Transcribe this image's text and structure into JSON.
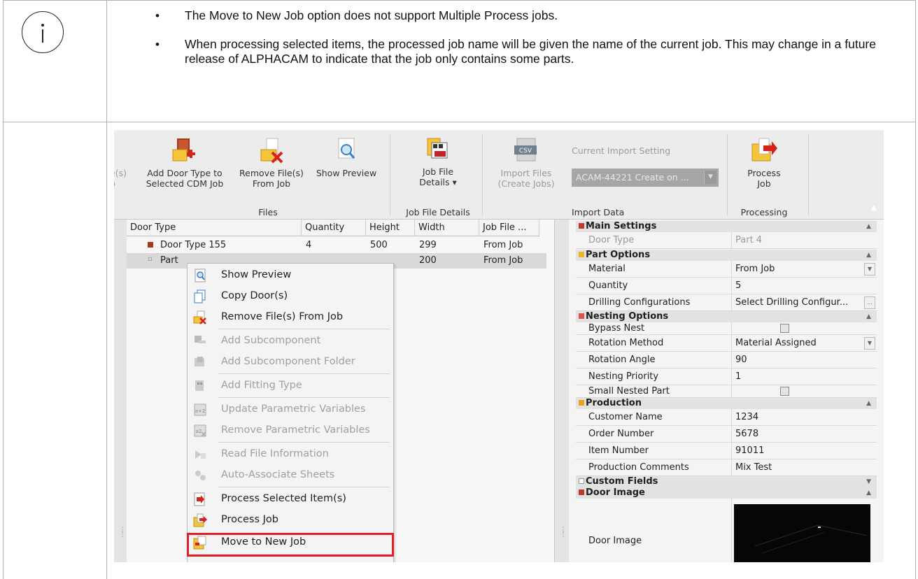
{
  "note": {
    "bullets": [
      "The Move to New Job option does not support Multiple Process jobs.",
      "When processing selected items, the processed job name will be given the name of the current job. This may change in a future release of  ALPHACAM to indicate that the job only contains some parts."
    ]
  },
  "ribbon": {
    "cut_label": "e(s)\nb",
    "add_door_type": "Add Door Type to\nSelected CDM Job",
    "remove_files": "Remove File(s)\nFrom Job",
    "show_preview": "Show Preview",
    "group_files": "Files",
    "job_file_details": "Job File\nDetails ▾",
    "group_job_file_details": "Job File Details",
    "import_files": "Import Files\n(Create Jobs)",
    "current_import_setting": "Current Import Setting",
    "import_setting_value": "ACAM-44221 Create on ...",
    "group_import_data": "Import Data",
    "process_job": "Process\nJob",
    "group_processing": "Processing"
  },
  "tree": {
    "columns": [
      "Door Type",
      "Quantity",
      "Height",
      "Width",
      "Job File ..."
    ],
    "rows": [
      {
        "name": "Door Type 155",
        "quantity": "4",
        "height": "500",
        "width": "299",
        "job_file": "From Job"
      },
      {
        "name": "Part",
        "quantity": "",
        "height": "",
        "width": "200",
        "job_file": "From Job"
      }
    ]
  },
  "context_menu": {
    "items": [
      {
        "label": "Show Preview",
        "enabled": true
      },
      {
        "label": "Copy Door(s)",
        "enabled": true
      },
      {
        "label": "Remove File(s) From Job",
        "enabled": true
      },
      {
        "label": "Add Subcomponent",
        "enabled": false
      },
      {
        "label": "Add Subcomponent Folder",
        "enabled": false
      },
      {
        "label": "Add Fitting Type",
        "enabled": false
      },
      {
        "label": "Update Parametric Variables",
        "enabled": false
      },
      {
        "label": "Remove Parametric Variables",
        "enabled": false
      },
      {
        "label": "Read File Information",
        "enabled": false
      },
      {
        "label": "Auto-Associate Sheets",
        "enabled": false
      },
      {
        "label": "Process Selected Item(s)",
        "enabled": true
      },
      {
        "label": "Process Job",
        "enabled": true
      },
      {
        "label": "Move to New Job",
        "enabled": true,
        "highlighted": true
      }
    ]
  },
  "properties": {
    "main_settings": "Main Settings",
    "door_type_key": "Door Type",
    "door_type_val": "Part 4",
    "part_options": "Part Options",
    "material_key": "Material",
    "material_val": "From Job",
    "quantity_key": "Quantity",
    "quantity_val": "5",
    "drilling_key": "Drilling Configurations",
    "drilling_val": "Select Drilling Configur...",
    "drilling_btn": "...",
    "nesting_options": "Nesting Options",
    "bypass_key": "Bypass Nest",
    "rotation_method_key": "Rotation Method",
    "rotation_method_val": "Material Assigned",
    "rotation_angle_key": "Rotation Angle",
    "rotation_angle_val": "90",
    "nesting_priority_key": "Nesting Priority",
    "nesting_priority_val": "1",
    "small_nested_key": "Small Nested Part",
    "production": "Production",
    "customer_key": "Customer Name",
    "customer_val": "1234",
    "order_key": "Order Number",
    "order_val": "5678",
    "item_key": "Item Number",
    "item_val": "91011",
    "comments_key": "Production Comments",
    "comments_val": "Mix Test",
    "custom_fields": "Custom Fields",
    "door_image": "Door Image",
    "door_image_key": "Door Image"
  },
  "colors": {
    "highlight": "#e21e26",
    "disabled_text": "#9a9a9a"
  }
}
